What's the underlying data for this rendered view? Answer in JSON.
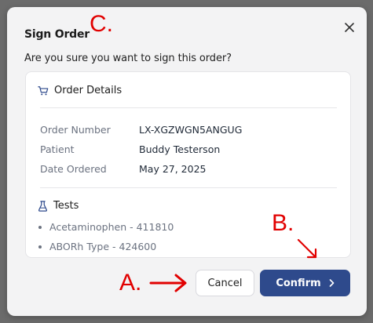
{
  "dialog": {
    "title": "Sign Order",
    "subtitle": "Are you sure you want to sign this order?",
    "close_icon": "close-icon"
  },
  "order_details": {
    "heading": "Order Details",
    "icon": "cart-icon",
    "rows": [
      {
        "label": "Order Number",
        "value": "LX-XGZWGN5ANGUG"
      },
      {
        "label": "Patient",
        "value": "Buddy Testerson"
      },
      {
        "label": "Date Ordered",
        "value": "May 27, 2025"
      }
    ]
  },
  "tests": {
    "heading": "Tests",
    "icon": "flask-icon",
    "items": [
      "Acetaminophen - 411810",
      "ABORh Type - 424600"
    ]
  },
  "buttons": {
    "cancel_label": "Cancel",
    "confirm_label": "Confirm",
    "confirm_icon": "chevron-right-icon"
  },
  "annotations": {
    "a": "A.",
    "b": "B.",
    "c": "C.",
    "color": "#e10000"
  }
}
